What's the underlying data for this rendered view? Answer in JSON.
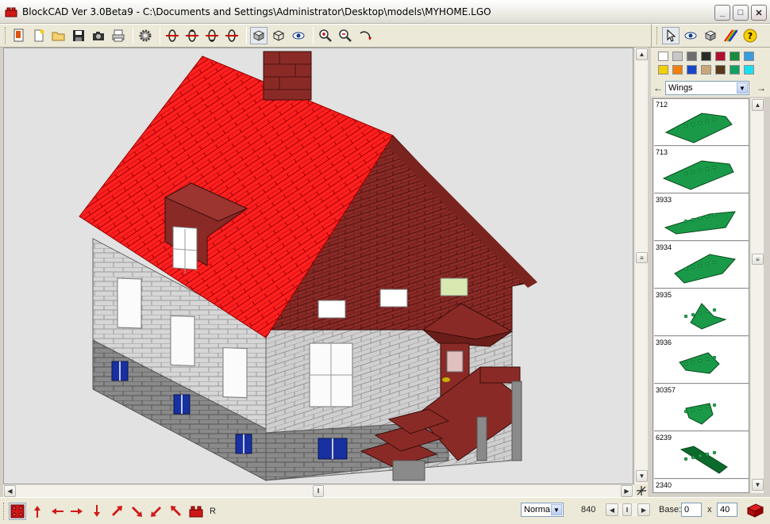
{
  "window": {
    "title": "BlockCAD Ver 3.0Beta9 - C:\\Documents and Settings\\Administrator\\Desktop\\models\\MYHOME.LGO",
    "minimize": "_",
    "maximize": "□",
    "close": "✕"
  },
  "toolbar": {
    "tools": [
      "new-icon",
      "open-icon",
      "save-icon",
      "camera-icon",
      "print-icon",
      "settings-icon",
      "rotate-up-icon",
      "rotate-down-icon",
      "rotate-left-icon",
      "rotate-right-icon",
      "view-solid-icon",
      "view-wire-icon",
      "visibility-icon",
      "zoom-in-icon",
      "zoom-out-icon",
      "undo-icon"
    ]
  },
  "side_toolbar": {
    "tools": [
      "pointer-icon",
      "eye-icon",
      "brick-icon",
      "rainbow-color-icon",
      "help-icon"
    ],
    "help_label": "?"
  },
  "palette": {
    "colors": [
      "#ffffff",
      "#c8c8c8",
      "#6e6e6e",
      "#2a2a2a",
      "#b01030",
      "#1a8a3c",
      "#3a9ae0",
      "#f0d000",
      "#f08010",
      "#1848c8",
      "#c8a878",
      "#5a3a1a",
      "#10a060",
      "#18e0f0"
    ]
  },
  "part_group": {
    "selected": "Wings",
    "prev_label": "←",
    "next_label": "→"
  },
  "parts": [
    {
      "id": "712"
    },
    {
      "id": "713"
    },
    {
      "id": "3933"
    },
    {
      "id": "3934"
    },
    {
      "id": "3935"
    },
    {
      "id": "3936"
    },
    {
      "id": "30357"
    },
    {
      "id": "6239"
    },
    {
      "id": "2340"
    }
  ],
  "statusbar": {
    "mode_value": "Norma",
    "brick_count": "840",
    "base_label": "Base:",
    "base_x": "0",
    "x_label": "x",
    "base_y": "40",
    "r_label": "R"
  }
}
